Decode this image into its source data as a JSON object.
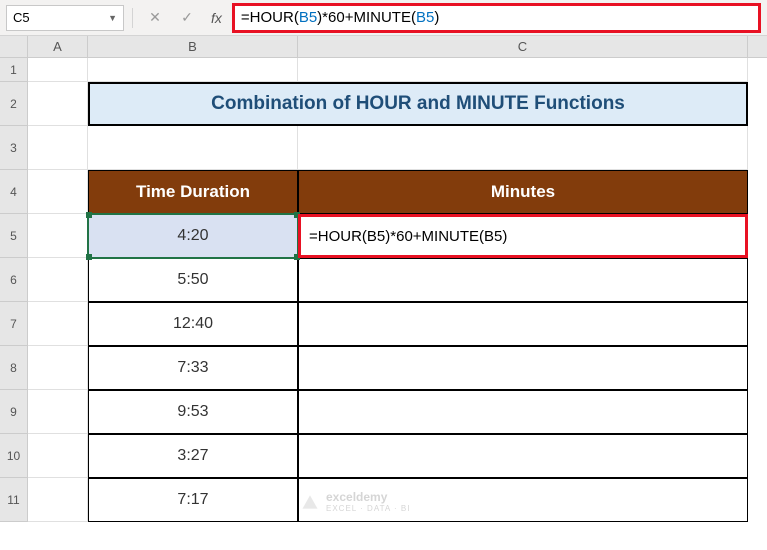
{
  "name_box": "C5",
  "formula_bar": {
    "prefix": "=HOUR(",
    "ref1": "B5",
    "mid": ")*60+MINUTE(",
    "ref2": "B5",
    "suffix": ")"
  },
  "columns": {
    "A": "A",
    "B": "B",
    "C": "C"
  },
  "rows": [
    "1",
    "2",
    "3",
    "4",
    "5",
    "6",
    "7",
    "8",
    "9",
    "10",
    "11"
  ],
  "title_banner": "Combination of HOUR and MINUTE Functions",
  "table": {
    "header_b": "Time Duration",
    "header_c": "Minutes",
    "data": [
      {
        "time": "4:20",
        "minutes_formula": "=HOUR(B5)*60+MINUTE(B5)"
      },
      {
        "time": "5:50"
      },
      {
        "time": "12:40"
      },
      {
        "time": "7:33"
      },
      {
        "time": "9:53"
      },
      {
        "time": "3:27"
      },
      {
        "time": "7:17"
      }
    ]
  },
  "watermark": {
    "brand": "exceldemy",
    "tag": "EXCEL · DATA · BI"
  },
  "chart_data": {
    "type": "table",
    "title": "Combination of HOUR and MINUTE Functions",
    "columns": [
      "Time Duration",
      "Minutes"
    ],
    "rows": [
      [
        "4:20",
        "=HOUR(B5)*60+MINUTE(B5)"
      ],
      [
        "5:50",
        ""
      ],
      [
        "12:40",
        ""
      ],
      [
        "7:33",
        ""
      ],
      [
        "9:53",
        ""
      ],
      [
        "3:27",
        ""
      ],
      [
        "7:17",
        ""
      ]
    ]
  }
}
